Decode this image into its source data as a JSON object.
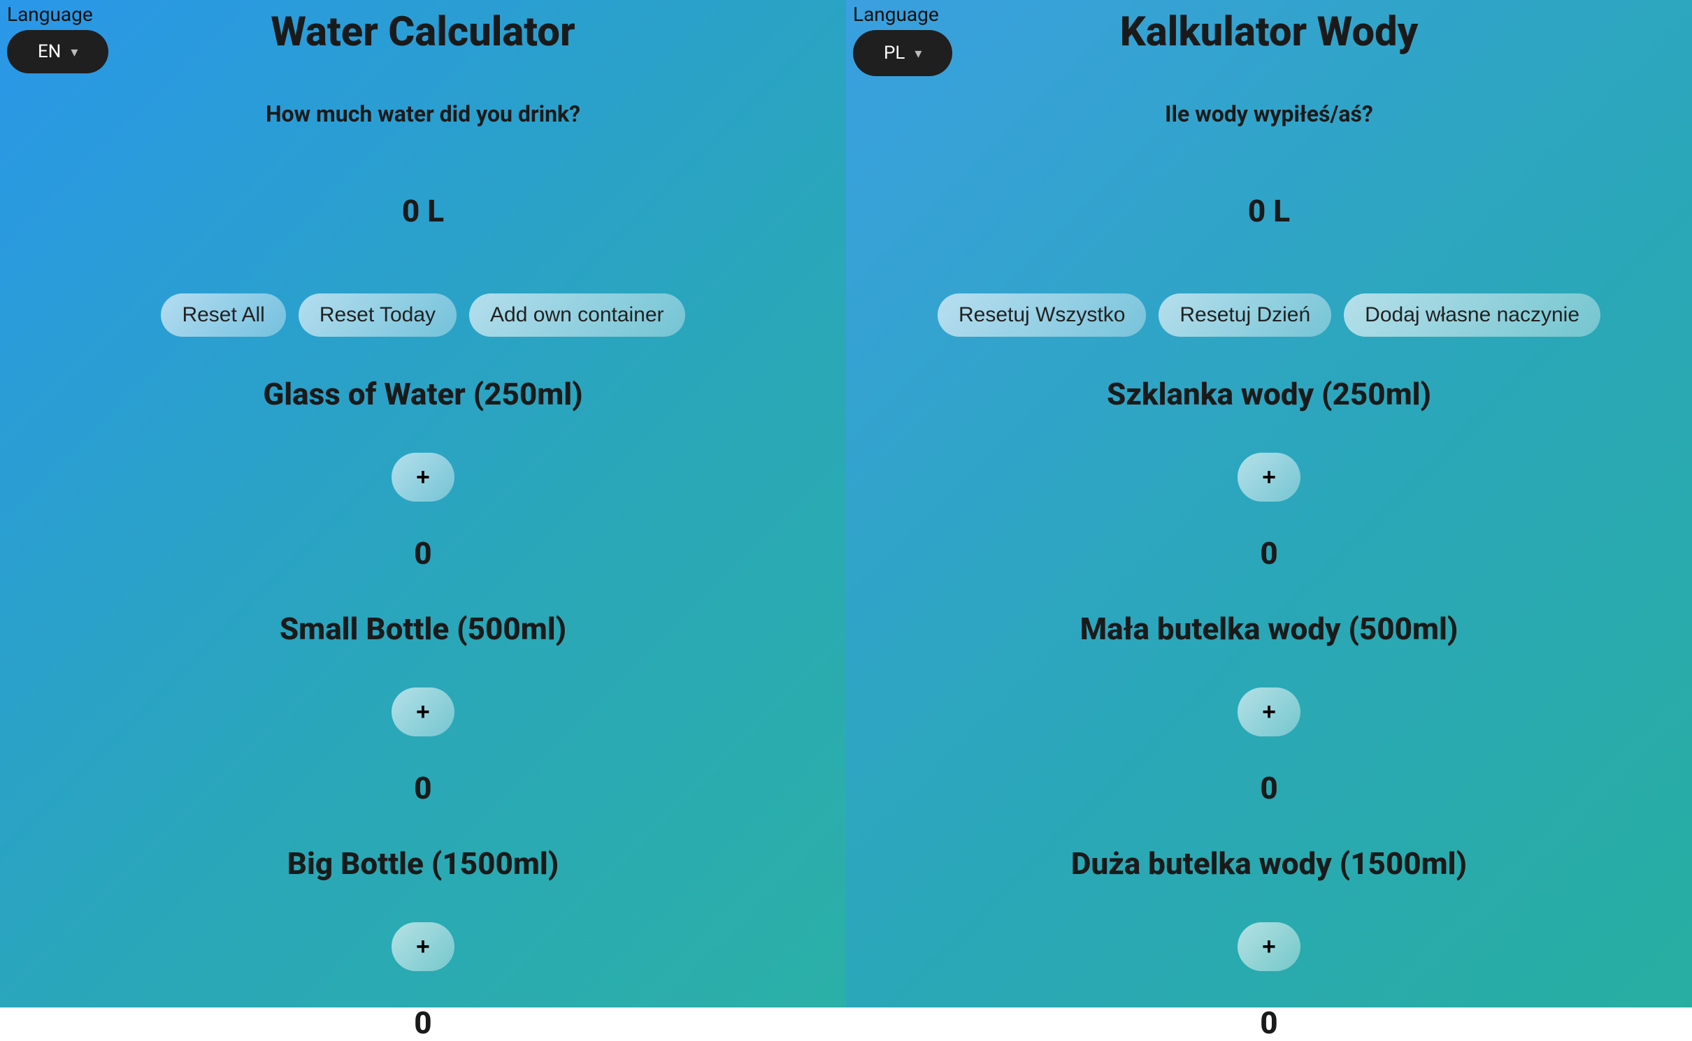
{
  "left": {
    "lang": {
      "label": "Language",
      "code": "EN"
    },
    "title": "Water Calculator",
    "subtitle": "How much water did you drink?",
    "total": "0 L",
    "actions": {
      "reset_all": "Reset All",
      "reset_today": "Reset Today",
      "add_own": "Add own container"
    },
    "containers": [
      {
        "title": "Glass of Water (250ml)",
        "plus": "+",
        "count": "0"
      },
      {
        "title": "Small Bottle (500ml)",
        "plus": "+",
        "count": "0"
      },
      {
        "title": "Big Bottle (1500ml)",
        "plus": "+",
        "count": "0"
      }
    ]
  },
  "right": {
    "lang": {
      "label": "Language",
      "code": "PL"
    },
    "title": "Kalkulator Wody",
    "subtitle": "Ile wody wypiłeś/aś?",
    "total": "0 L",
    "actions": {
      "reset_all": "Resetuj Wszystko",
      "reset_today": "Resetuj Dzień",
      "add_own": "Dodaj własne naczynie"
    },
    "containers": [
      {
        "title": "Szklanka wody (250ml)",
        "plus": "+",
        "count": "0"
      },
      {
        "title": "Mała butelka wody (500ml)",
        "plus": "+",
        "count": "0"
      },
      {
        "title": "Duża butelka wody (1500ml)",
        "plus": "+",
        "count": "0"
      }
    ]
  }
}
